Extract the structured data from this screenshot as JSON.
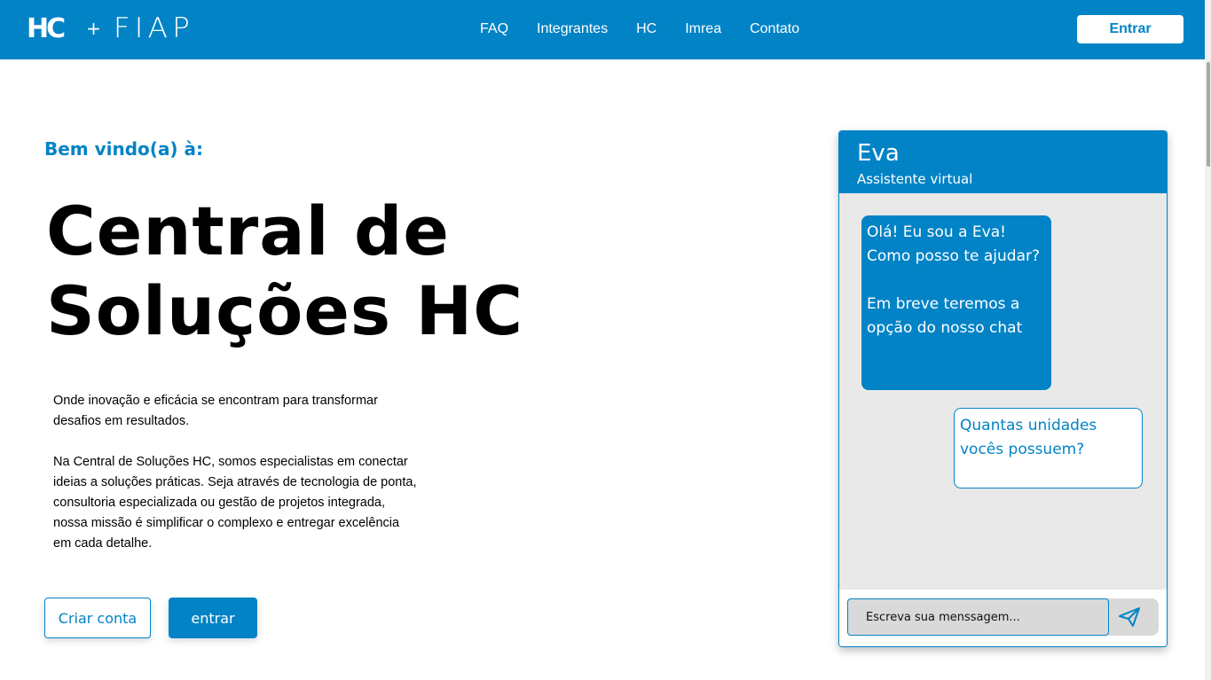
{
  "header": {
    "logo_hc": "HC",
    "logo_plus": "+",
    "logo_fiap": "FIAP",
    "nav": [
      "FAQ",
      "Integrantes",
      "HC",
      "Imrea",
      "Contato"
    ],
    "login_label": "Entrar"
  },
  "hero": {
    "welcome": "Bem vindo(a) à:",
    "title": "Central de Soluções HC",
    "intro_1": "Onde inovação e eficácia se encontram para transformar desafios em resultados.",
    "intro_2": "Na Central de Soluções HC, somos especialistas em conectar ideias a soluções práticas. Seja através de tecnologia de ponta, consultoria especializada ou gestão de projetos integrada, nossa missão é simplificar o complexo e entregar excelência em cada detalhe.",
    "create_account_label": "Criar conta",
    "enter_label": "entrar"
  },
  "chat": {
    "name": "Eva",
    "subtitle": "Assistente virtual",
    "bot_message": "Olá! Eu sou a Eva! Como posso te ajudar?\n\nEm breve teremos a opção do nosso chat",
    "user_message": "Quantas unidades vocês possuem?",
    "input_placeholder": "Escreva sua menssagem...",
    "send_icon": "send-icon"
  },
  "colors": {
    "primary": "#0283c6",
    "chat_background": "#e9e9e9",
    "input_background": "#d9d9d9"
  }
}
